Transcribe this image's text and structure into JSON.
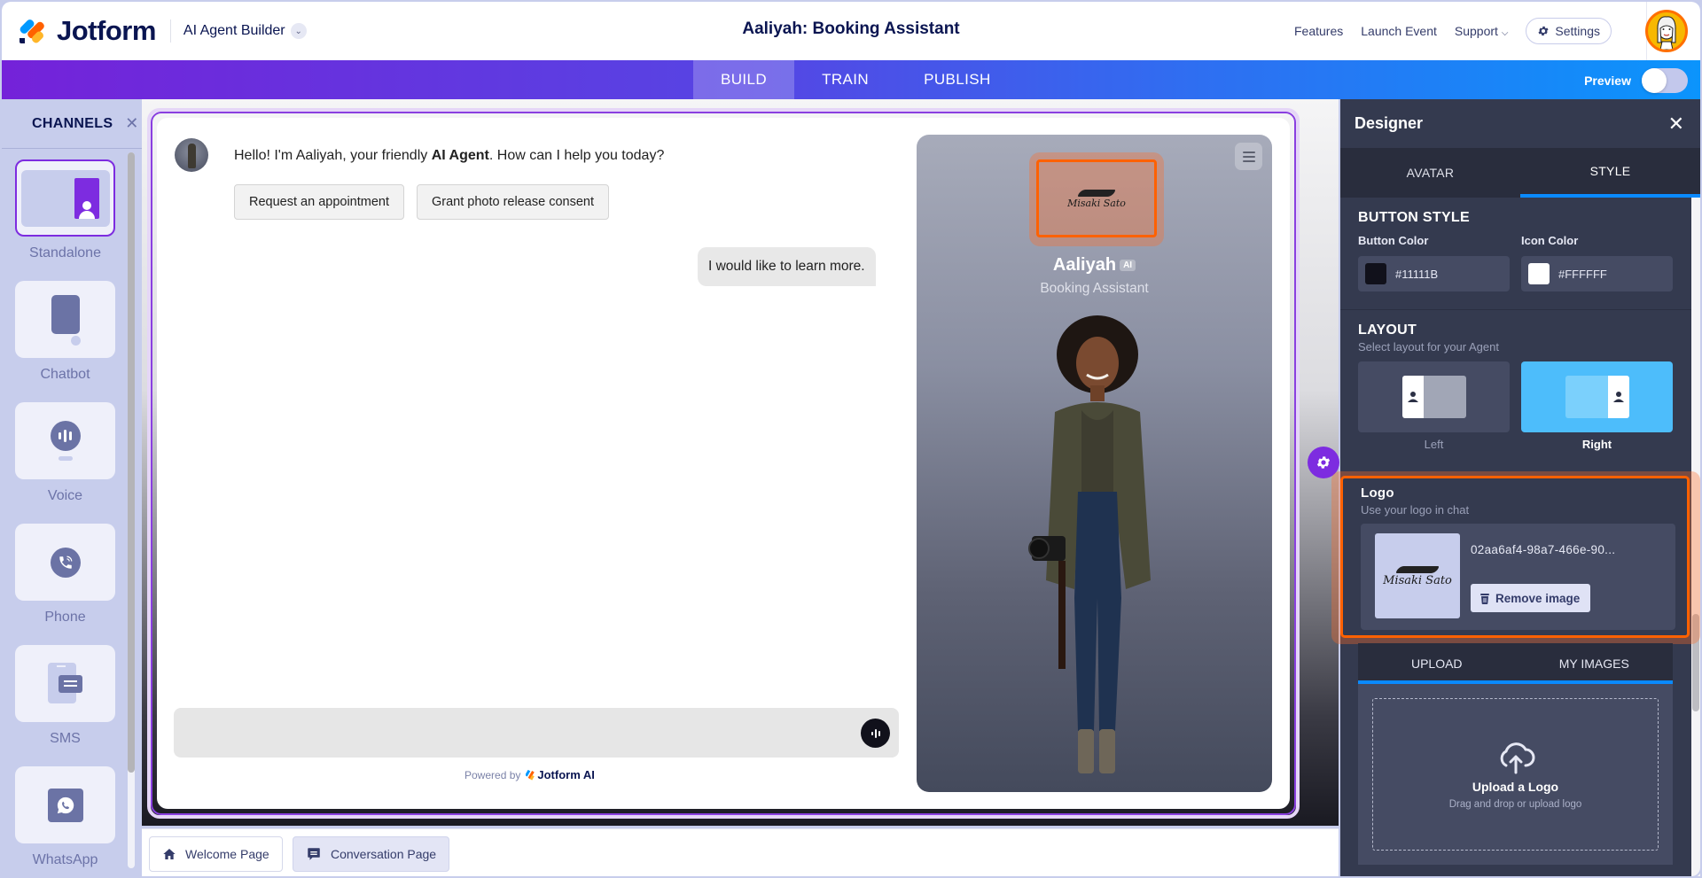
{
  "header": {
    "brand": "Jotform",
    "product": "AI Agent Builder",
    "agent_title": "Aaliyah: Booking Assistant",
    "links": [
      "Features",
      "Launch Event",
      "Support"
    ],
    "settings_label": "Settings"
  },
  "nav": {
    "tabs": [
      {
        "label": "BUILD",
        "active": true
      },
      {
        "label": "TRAIN",
        "active": false
      },
      {
        "label": "PUBLISH",
        "active": false
      }
    ],
    "preview_label": "Preview",
    "preview_enabled": false
  },
  "channels": {
    "title": "CHANNELS",
    "items": [
      {
        "label": "Standalone",
        "icon": "standalone-icon",
        "selected": true
      },
      {
        "label": "Chatbot",
        "icon": "chatbot-icon",
        "selected": false
      },
      {
        "label": "Voice",
        "icon": "voice-icon",
        "selected": false
      },
      {
        "label": "Phone",
        "icon": "phone-icon",
        "selected": false
      },
      {
        "label": "SMS",
        "icon": "sms-icon",
        "selected": false
      },
      {
        "label": "WhatsApp",
        "icon": "whatsapp-icon",
        "selected": false
      }
    ]
  },
  "chat": {
    "greeting_pre": "Hello! I'm Aaliyah, your friendly ",
    "greeting_bold": "AI Agent",
    "greeting_post": ". How can I help you today?",
    "quick_replies": [
      "Request an appointment",
      "Grant photo release consent"
    ],
    "user_message": "I would like to learn more.",
    "input_value": "",
    "powered_by": "Powered by",
    "powered_brand": "Jotform AI"
  },
  "agent_card": {
    "logo_text": "Misaki Sato",
    "name": "Aaliyah",
    "badge": "AI",
    "role": "Booking Assistant"
  },
  "page_tabs": [
    {
      "label": "Welcome Page",
      "icon": "home-icon",
      "active": false
    },
    {
      "label": "Conversation Page",
      "icon": "chat-icon",
      "active": true
    }
  ],
  "designer": {
    "title": "Designer",
    "tabs": [
      {
        "label": "AVATAR",
        "active": false
      },
      {
        "label": "STYLE",
        "active": true
      }
    ],
    "button_style": {
      "title": "BUTTON STYLE",
      "button_color_label": "Button Color",
      "button_color": "#11111B",
      "icon_color_label": "Icon Color",
      "icon_color": "#FFFFFF"
    },
    "layout": {
      "title": "LAYOUT",
      "subtitle": "Select layout for your Agent",
      "options": [
        {
          "label": "Left",
          "selected": false
        },
        {
          "label": "Right",
          "selected": true
        }
      ]
    },
    "logo": {
      "title": "Logo",
      "subtitle": "Use your logo in chat",
      "filename": "02aa6af4-98a7-466e-90...",
      "remove_label": "Remove image",
      "upload_tabs": [
        {
          "label": "UPLOAD",
          "active": true
        },
        {
          "label": "MY IMAGES",
          "active": false
        }
      ],
      "upload_title": "Upload a Logo",
      "upload_subtitle": "Drag and drop or upload logo"
    }
  },
  "colors": {
    "accent_purple": "#7D2CE0",
    "accent_blue": "#0A8AFF",
    "highlight_orange": "#FF6100",
    "layout_selected": "#4DBDFB"
  }
}
